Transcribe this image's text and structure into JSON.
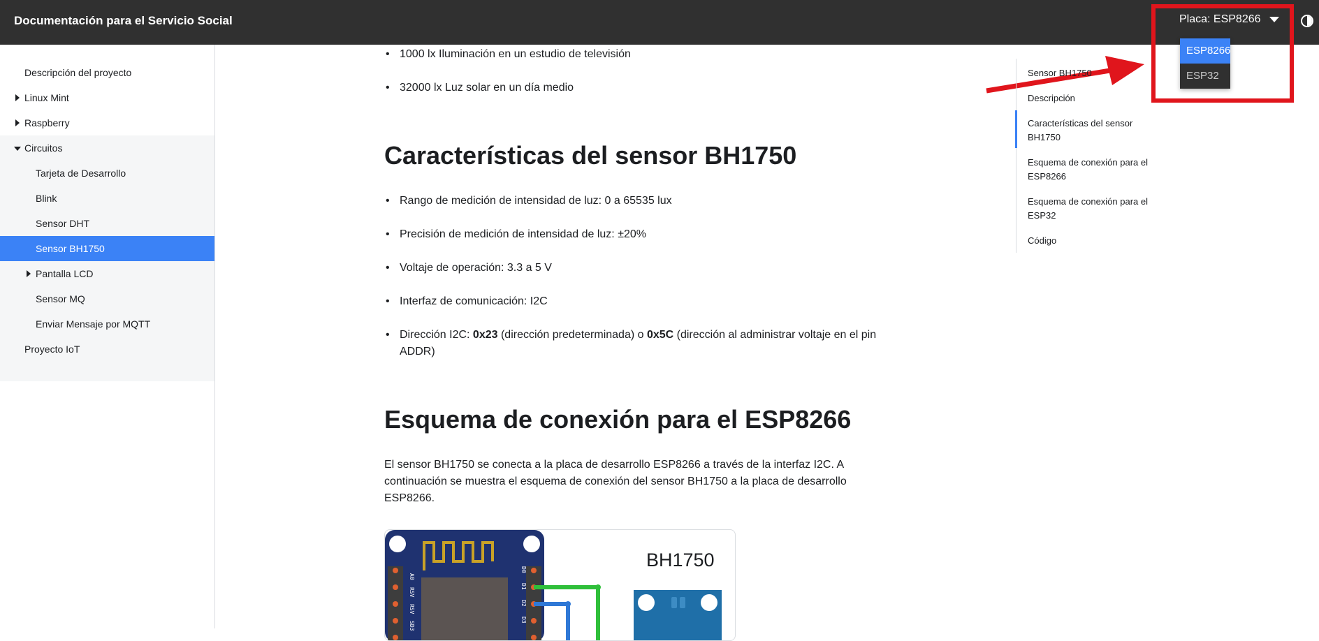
{
  "navbar": {
    "title": "Documentación para el Servicio Social",
    "board_select_label": "Placa: ESP8266",
    "theme_toggle_icon": "contrast-icon"
  },
  "dropdown": {
    "options": [
      "ESP8266",
      "ESP32"
    ],
    "selected": "ESP8266"
  },
  "sidebar": {
    "items": [
      {
        "label": "Descripción del proyecto"
      },
      {
        "label": "Linux Mint"
      },
      {
        "label": "Raspberry"
      },
      {
        "label": "Circuitos"
      },
      {
        "label": "Tarjeta de Desarrollo"
      },
      {
        "label": "Blink"
      },
      {
        "label": "Sensor DHT"
      },
      {
        "label": "Sensor BH1750"
      },
      {
        "label": "Pantalla LCD"
      },
      {
        "label": "Sensor MQ"
      },
      {
        "label": "Enviar Mensaje por MQTT"
      },
      {
        "label": "Proyecto IoT"
      }
    ]
  },
  "content": {
    "intro_bullets": [
      "1000 lx Iluminación en un estudio de televisión",
      "32000 lx Luz solar en un día medio"
    ],
    "section1_title": "Características del sensor BH1750",
    "features": [
      "Rango de medición de intensidad de luz: 0 a 65535 lux",
      "Precisión de medición de intensidad de luz: ±20%",
      "Voltaje de operación: 3.3 a 5 V",
      "Interfaz de comunicación: I2C"
    ],
    "address": {
      "prefix": "Dirección I2C: ",
      "addr1": "0x23",
      "mid": " (dirección predeterminada) o ",
      "addr2": "0x5C",
      "suffix": " (dirección al administrar voltaje en el pin ADDR)"
    },
    "section2_title": "Esquema de conexión para el ESP8266",
    "section2_paragraph": "El sensor BH1750 se conecta a la placa de desarrollo ESP8266 a través de la interfaz I2C. A continuación se muestra el esquema de conexión del sensor BH1750 a la placa de desarrollo ESP8266.",
    "diagram": {
      "sensor_label": "BH1750",
      "pin_labels_left": [
        "A0",
        "RSV",
        "RSV",
        "SD3"
      ],
      "pin_labels_right": [
        "D0",
        "D1",
        "D2",
        "D3"
      ]
    }
  },
  "toc": {
    "items": [
      "Sensor BH1750",
      "Descripción",
      "Características del sensor BH1750",
      "Esquema de conexión para el ESP8266",
      "Esquema de conexión para el ESP32",
      "Código"
    ]
  },
  "colors": {
    "navbar_bg": "#303030",
    "accent": "#3b82f6",
    "annotation_red": "#e0151c"
  }
}
